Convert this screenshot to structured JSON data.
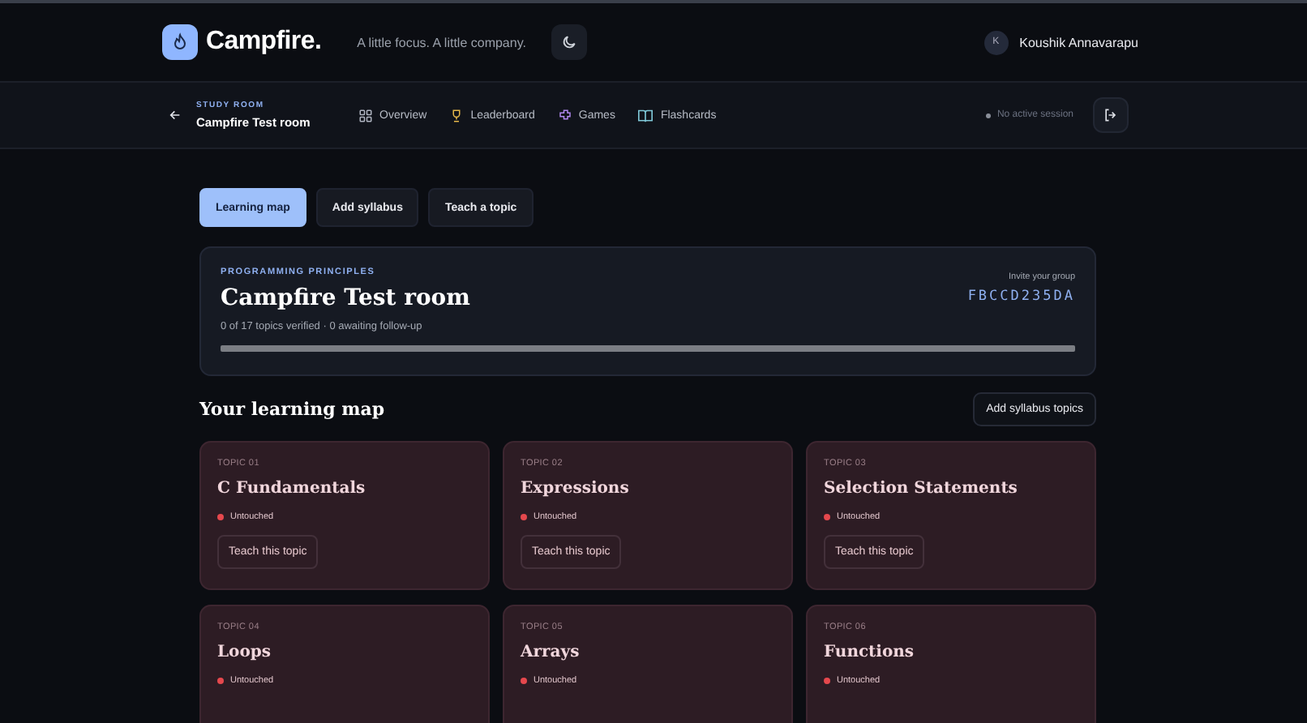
{
  "brand": {
    "name": "Campfire.",
    "tagline": "A little focus. A little company."
  },
  "user": {
    "initial": "K",
    "name": "Koushik Annavarapu"
  },
  "room_bar": {
    "eyebrow": "STUDY ROOM",
    "title": "Campfire Test room",
    "session": "No active session",
    "nav": [
      {
        "label": "Overview"
      },
      {
        "label": "Leaderboard"
      },
      {
        "label": "Games"
      },
      {
        "label": "Flashcards"
      }
    ]
  },
  "tabs": [
    {
      "label": "Learning map",
      "selected": true
    },
    {
      "label": "Add syllabus",
      "selected": false
    },
    {
      "label": "Teach a topic",
      "selected": false
    }
  ],
  "summary": {
    "eyebrow": "PROGRAMMING PRINCIPLES",
    "title": "Campfire Test room",
    "stats": "0 of 17 topics verified · 0 awaiting follow-up",
    "invite_label": "Invite your group",
    "invite_code": "FBCCD235DA",
    "level": 0
  },
  "learning_map": {
    "heading": "Your learning map",
    "button": "Add syllabus topics",
    "topics": [
      {
        "number": "TOPIC 01",
        "title": "C Fundamentals",
        "status": "Untouched",
        "color": "#e5484d",
        "action": "Teach this topic"
      },
      {
        "number": "TOPIC 02",
        "title": "Expressions",
        "status": "Untouched",
        "color": "#e5484d",
        "action": "Teach this topic"
      },
      {
        "number": "TOPIC 03",
        "title": "Selection Statements",
        "status": "Untouched",
        "color": "#e5484d",
        "action": "Teach this topic"
      },
      {
        "number": "TOPIC 04",
        "title": "Loops",
        "status": "Untouched",
        "color": "#e5484d"
      },
      {
        "number": "TOPIC 05",
        "title": "Arrays",
        "status": "Untouched",
        "color": "#e5484d"
      },
      {
        "number": "TOPIC 06",
        "title": "Functions",
        "status": "Untouched",
        "color": "#e5484d"
      }
    ]
  }
}
